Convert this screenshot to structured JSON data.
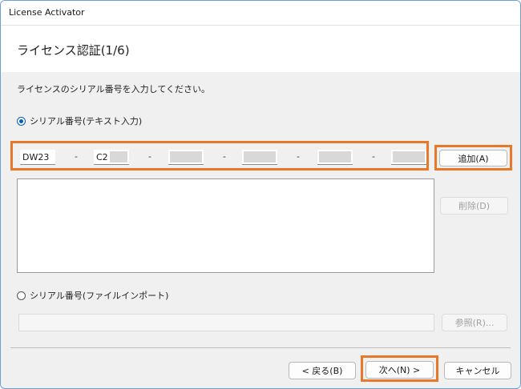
{
  "window": {
    "title": "License Activator"
  },
  "header": {
    "page_title": "ライセンス認証(1/6)"
  },
  "main": {
    "instruction": "ライセンスのシリアル番号を入力してください。",
    "radio_text_input": {
      "label": "シリアル番号(テキスト入力)",
      "selected": true
    },
    "serial_segments": [
      {
        "value": "DW23"
      },
      {
        "value": "C2"
      },
      {
        "value": ""
      },
      {
        "value": ""
      },
      {
        "value": ""
      },
      {
        "value": ""
      }
    ],
    "separator": "-",
    "add_button": "追加(A)",
    "delete_button": "削除(D)",
    "radio_file_import": {
      "label": "シリアル番号(ファイルインポート)",
      "selected": false
    },
    "browse_button": "参照(R)..."
  },
  "footer": {
    "back_button": "< 戻る(B)",
    "next_button": "次へ(N) >",
    "cancel_button": "キャンセル"
  },
  "colors": {
    "highlight": "#e8782a",
    "accent": "#005fb8",
    "frame": "#6a9fd8"
  }
}
